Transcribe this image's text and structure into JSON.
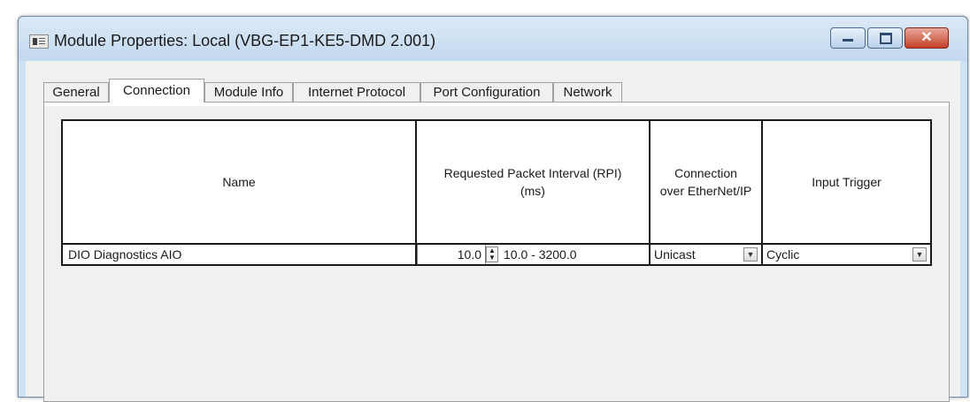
{
  "window": {
    "title": "Module Properties: Local (VBG-EP1-KE5-DMD 2.001)",
    "controls": {
      "minimize": "minimize-icon",
      "maximize": "maximize-icon",
      "close": "close-icon",
      "close_glyph": "✕"
    }
  },
  "tabs": [
    {
      "label": "General",
      "active": false
    },
    {
      "label": "Connection",
      "active": true
    },
    {
      "label": "Module Info",
      "active": false
    },
    {
      "label": "Internet Protocol",
      "active": false
    },
    {
      "label": "Port Configuration",
      "active": false
    },
    {
      "label": "Network",
      "active": false
    }
  ],
  "table": {
    "columns": {
      "name": "Name",
      "rpi": "Requested Packet Interval (RPI)\n(ms)",
      "connection": "Connection\nover EtherNet/IP",
      "trigger": "Input Trigger"
    },
    "rows": [
      {
        "name": "DIO Diagnostics AIO",
        "rpi": "10.0",
        "rpi_range": "10.0 - 3200.0",
        "connection": "Unicast",
        "trigger": "Cyclic"
      }
    ]
  },
  "colors": {
    "frame": "#cfe2f4",
    "close_button": "#c5402a",
    "dialog_background": "#f0f0f0"
  }
}
